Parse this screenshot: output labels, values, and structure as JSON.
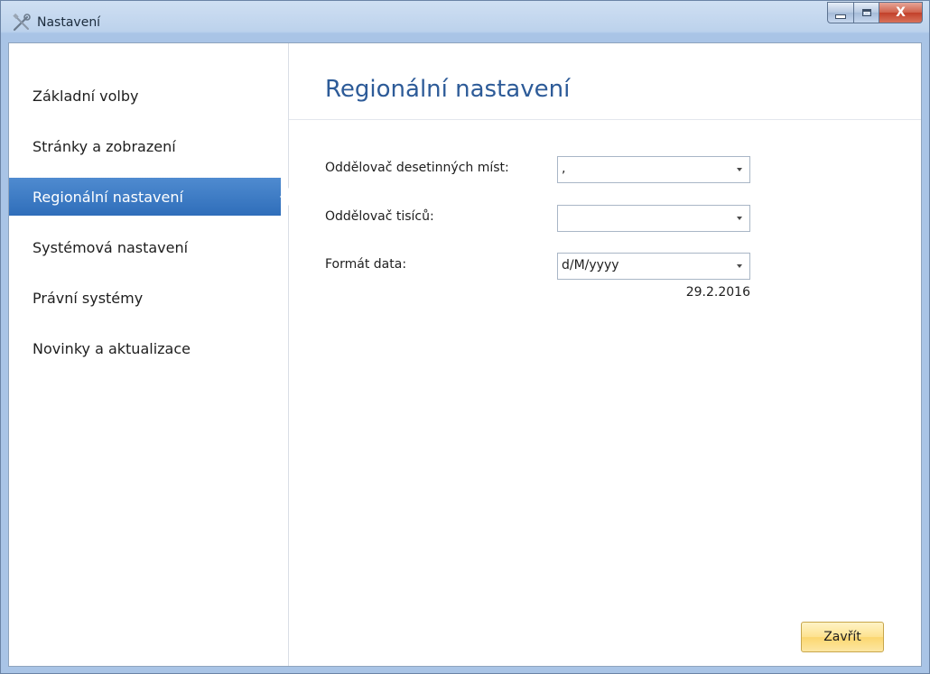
{
  "window": {
    "title": "Nastavení",
    "icon": "tools-icon",
    "controls": {
      "minimize_icon": "minimize-icon",
      "maximize_icon": "maximize-icon",
      "close_label": "X"
    }
  },
  "sidebar": {
    "items": [
      {
        "label": "Základní volby",
        "selected": false
      },
      {
        "label": "Stránky a zobrazení",
        "selected": false
      },
      {
        "label": "Regionální nastavení",
        "selected": true
      },
      {
        "label": "Systémová nastavení",
        "selected": false
      },
      {
        "label": "Právní systémy",
        "selected": false
      },
      {
        "label": "Novinky a aktualizace",
        "selected": false
      }
    ],
    "selected_color": "#3a78c3"
  },
  "main": {
    "title": "Regionální nastavení",
    "fields": {
      "decimal_separator": {
        "label": "Oddělovač desetinných míst:",
        "value": ","
      },
      "thousands_separator": {
        "label": "Oddělovač tisíců:",
        "value": ""
      },
      "date_format": {
        "label": "Formát data:",
        "value": "d/M/yyyy"
      }
    },
    "date_preview": "29.2.2016",
    "close_button": "Zavřít"
  }
}
